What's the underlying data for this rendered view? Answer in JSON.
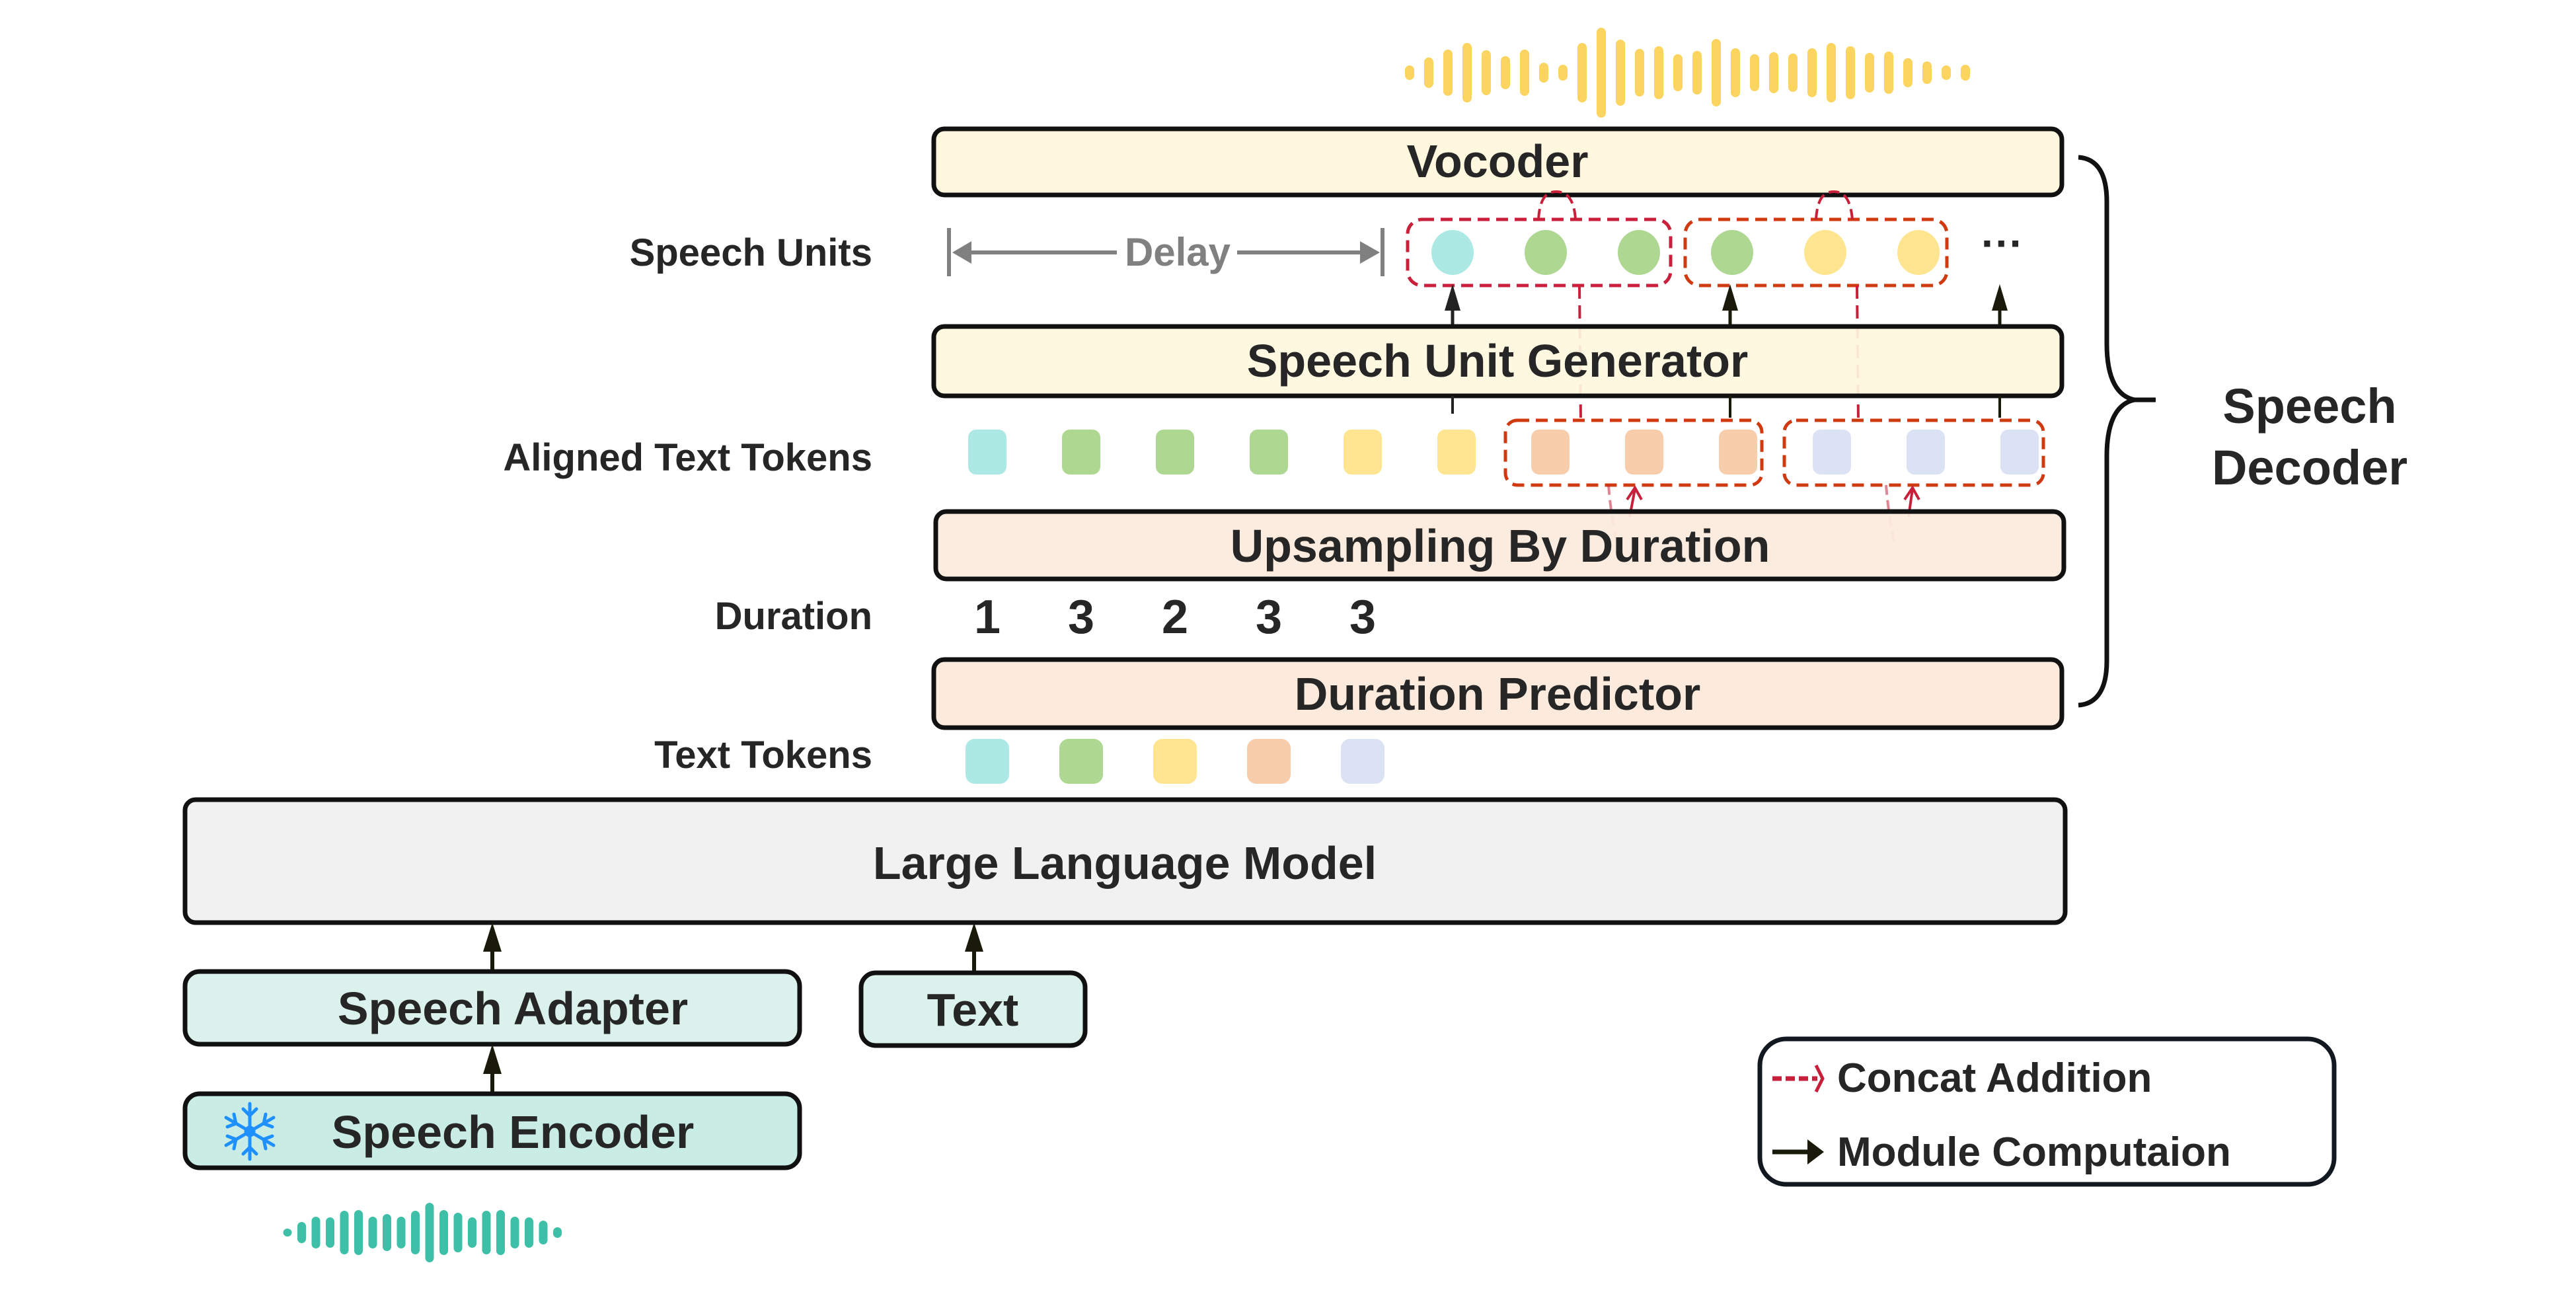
{
  "figure": {
    "row_labels": {
      "speech_units": "Speech Units",
      "aligned_text_tokens": "Aligned Text Tokens",
      "duration": "Duration",
      "text_tokens": "Text Tokens"
    },
    "modules": {
      "vocoder": "Vocoder",
      "speech_unit_generator": "Speech Unit Generator",
      "upsampling": "Upsampling By Duration",
      "duration_predictor": "Duration Predictor",
      "llm": "Large Language Model",
      "speech_adapter": "Speech Adapter",
      "text": "Text",
      "speech_encoder": "Speech Encoder"
    },
    "speech_encoder_icon": "snowflake-icon",
    "speech_encoder_frozen": true,
    "delay_label": "Delay",
    "ellipsis": "···",
    "bracket_label_line1": "Speech",
    "bracket_label_line2": "Decoder",
    "durations": [
      "1",
      "3",
      "2",
      "3",
      "3"
    ],
    "text_tokens": [
      "cyan",
      "green",
      "yellow",
      "orange",
      "blue"
    ],
    "aligned_text_tokens": [
      "cyan",
      "green",
      "green",
      "green",
      "yellow",
      "yellow",
      "orange",
      "orange",
      "orange",
      "blue",
      "blue",
      "blue"
    ],
    "speech_units": [
      "cyan",
      "green",
      "green",
      "green",
      "yellow",
      "yellow"
    ],
    "token_colors": {
      "cyan": "#ACE9E4",
      "green": "#AED891",
      "yellow": "#FFE590",
      "orange": "#F8CDAB",
      "blue": "#DAE2F4"
    },
    "box_colors": {
      "yellow_module": "#FFF7DE",
      "orange_module": "#FCEBDD",
      "llm": "#F1F1F1",
      "speech_adapter": "#DBF2EC",
      "speech_encoder": "#C9ECE4"
    },
    "waveform_colors": {
      "output": "#FBD560",
      "input": "#3EBFA7"
    },
    "accent_colors": {
      "concat_dash": "#C8203A",
      "concat_dash_alt": "#D03A10",
      "arrow": "#1A1A0A",
      "snowflake": "#1E90FF",
      "delay": "#808080"
    },
    "legend": {
      "items": [
        {
          "icon": "dashed-red-arrow-icon",
          "label": "Concat Addition"
        },
        {
          "icon": "solid-black-arrow-icon",
          "label": "Module Computaion"
        }
      ]
    }
  }
}
